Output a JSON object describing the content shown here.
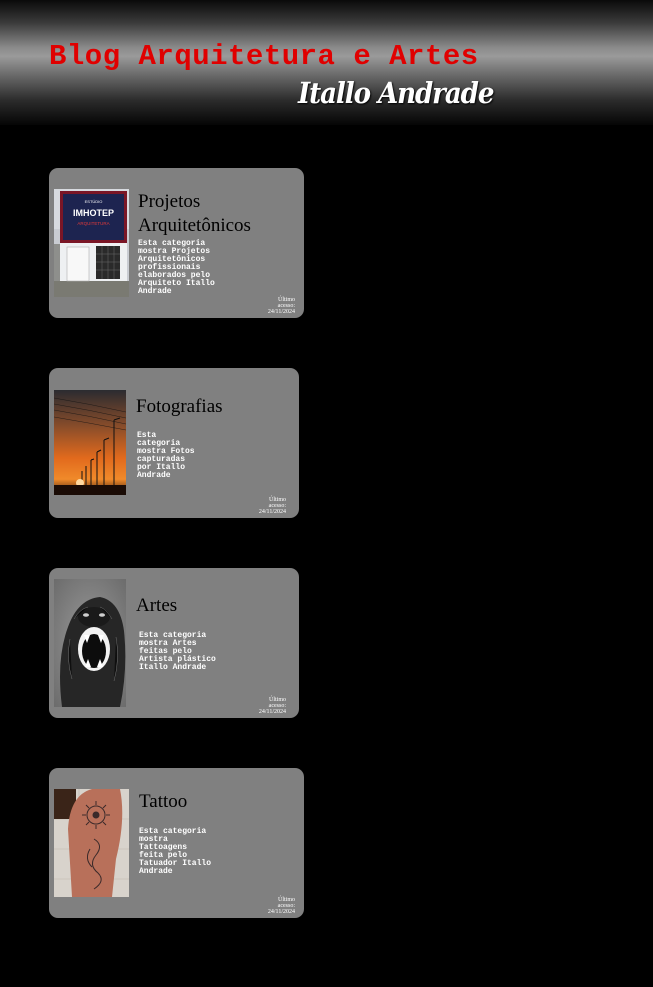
{
  "header": {
    "title": "Blog Arquitetura e Artes",
    "author": "Itallo Andrade"
  },
  "cards": [
    {
      "title": "Projetos Arquitetônicos",
      "description": "Esta categoria\nmostra Projetos\nArquitetônicos\nprofissionais\nelaborados pelo\nArquiteto Itallo\nAndrade",
      "access_label": "Último\nacesso:",
      "access_date": "24/11/2024",
      "image_text": {
        "small": "ESTÚDIO",
        "brand": "IMHOTEP",
        "sub": "ARQUITETURA"
      }
    },
    {
      "title": "Fotografias",
      "description": "Esta\ncategoria\nmostra Fotos\ncapturadas\npor Itallo\nAndrade",
      "access_label": "Último\nacesso:",
      "access_date": "24/11/2024"
    },
    {
      "title": "Artes",
      "description": "Esta categoria\nmostra Artes\nfeitas pelo\nArtista plástico\nItallo Andrade",
      "access_label": "Último\nacesso:",
      "access_date": "24/11/2024"
    },
    {
      "title": "Tattoo",
      "description": "Esta categoria\nmostra\nTattoagens\nfeita pelo\nTatuador Itallo\nAndrade",
      "access_label": "Último\nacesso:",
      "access_date": "24/11/2024"
    }
  ],
  "colors": {
    "background": "#000000",
    "title_red": "#e00000",
    "card_gray": "#808080"
  }
}
